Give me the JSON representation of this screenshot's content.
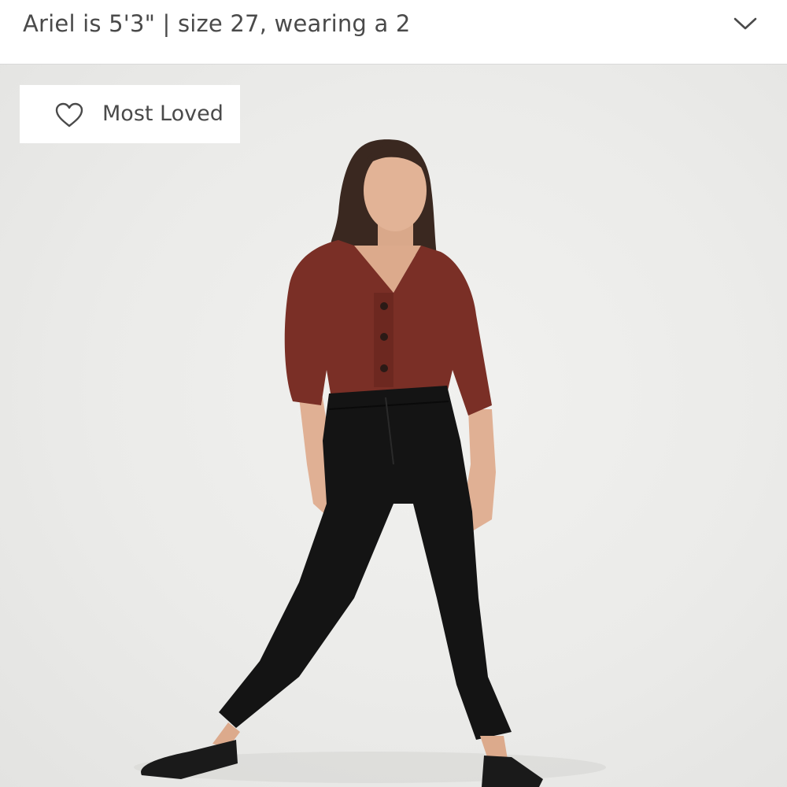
{
  "header": {
    "title": "Ariel is 5'3\" | size 27, wearing a 2",
    "toggle_icon": "chevron-down-icon"
  },
  "badge": {
    "icon": "heart-outline-icon",
    "label": "Most Loved"
  },
  "photo": {
    "subject": "model-wearing-burgundy-cardigan-and-black-pants"
  },
  "colors": {
    "text": "#4a4a4a",
    "background": "#ebebe9",
    "cardigan": "#7a2f26",
    "pants": "#141414"
  }
}
